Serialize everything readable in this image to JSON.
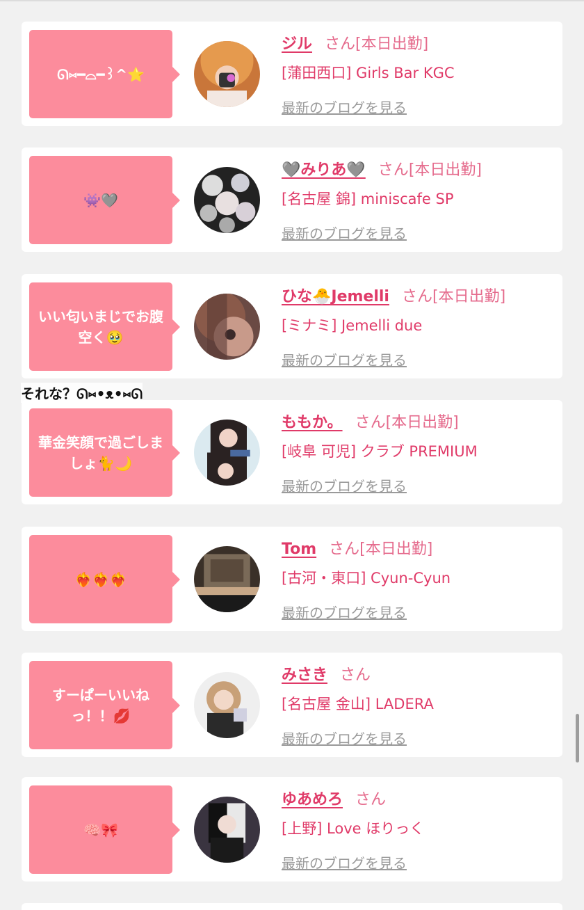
{
  "overlay": {
    "text": "それな？ᘏ⑅•ᴥ•⑅ᘏ"
  },
  "blog_link_label": "最新のブログを見る",
  "colors": {
    "pink_bubble": "#fc8c9c",
    "name_pink": "#e03a68",
    "background": "#f1f1f1"
  },
  "entries": [
    {
      "comment": "ᘏ⑅━⌓━꒱^⭐️",
      "name": "ジル",
      "san": "さん",
      "status": "[本日出勤]",
      "shop": "[蒲田西口] Girls Bar KGC",
      "avatar_icon": "selfie-photo"
    },
    {
      "comment": "👾🩶",
      "name": "🩶みりあ🩶",
      "san": "さん",
      "status": "[本日出勤]",
      "shop": "[名古屋 錦] miniscafe SP",
      "avatar_icon": "collage-photo"
    },
    {
      "comment": "いい匂いまじでお腹空く🥹",
      "name": "ひな🐣Jemelli",
      "san": "さん",
      "status": "[本日出勤]",
      "shop": "[ミナミ] Jemelli due",
      "avatar_icon": "closeup-photo"
    },
    {
      "comment": "華金笑顔で過ごしましょ🐈🌙",
      "name": "ももか。",
      "san": "さん",
      "status": "[本日出勤]",
      "shop": "[岐阜 可児] クラブ PREMIUM",
      "avatar_icon": "portrait-photo"
    },
    {
      "comment": "❤️‍🔥❤️‍🔥❤️‍🔥",
      "name": "Tom",
      "san": "さん",
      "status": "[本日出勤]",
      "shop": "[古河・東口] Cyun-Cyun",
      "avatar_icon": "bar-interior-photo"
    },
    {
      "comment": "すーぱーいいねっ！！💋",
      "name": "みさき",
      "san": "さん",
      "status": "",
      "shop": "[名古屋 金山] LADERA",
      "avatar_icon": "selfie-photo"
    },
    {
      "comment": "🧠🎀",
      "name": "ゆあめろ",
      "san": "さん",
      "status": "",
      "shop": "[上野] Love ほりっく",
      "avatar_icon": "portrait-photo"
    }
  ]
}
